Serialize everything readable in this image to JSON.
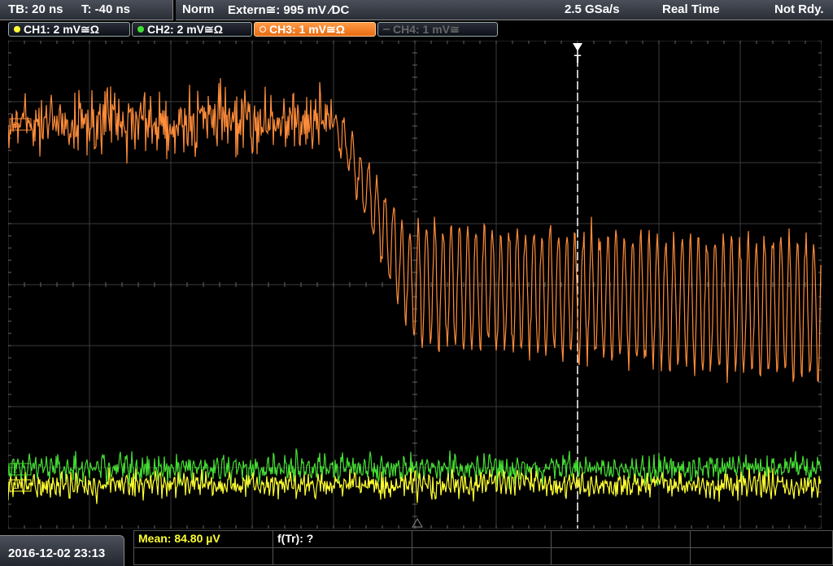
{
  "timebase": {
    "tb": "TB: 20 ns",
    "t": "T: -40 ns"
  },
  "trigger_status": {
    "mode": "Norm",
    "source": "Extern≅: 995 mV ∕DC",
    "sample_rate": "2.5 GSa/s",
    "acq_mode": "Real Time",
    "state": "Not Rdy."
  },
  "channels": [
    {
      "label": "CH1: 2 mV≅Ω",
      "color": "#ffff33",
      "active": false,
      "enabled": true
    },
    {
      "label": "CH2: 2 mV≅Ω",
      "color": "#44dd33",
      "active": false,
      "enabled": true
    },
    {
      "label": "CH3: 1 mV≅Ω",
      "color": "#ff8c3a",
      "active": true,
      "enabled": true
    },
    {
      "label": "CH4: 1 mV≅",
      "color": "#555555",
      "active": false,
      "enabled": false
    }
  ],
  "trigger_marker": "T",
  "date_time": "2016-12-02 23:13",
  "measurements": {
    "mean": "Mean: 84.80 µV",
    "rise_freq": "f(Tr): ?"
  },
  "colors": {
    "ch1": "#ffff33",
    "ch2": "#44dd33",
    "ch3": "#ff8c3a",
    "grid": "#3a3a3a",
    "meas_text": "#ffff33"
  }
}
